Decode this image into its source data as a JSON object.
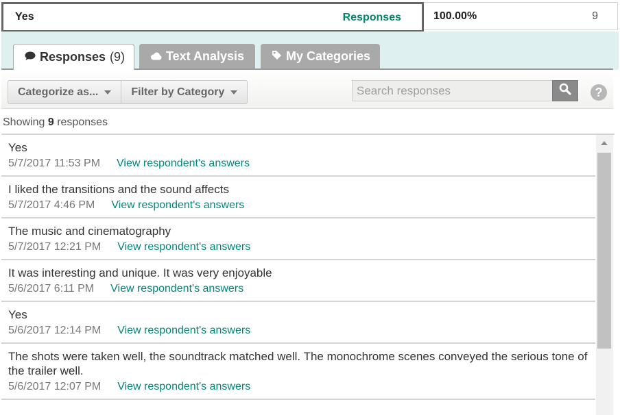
{
  "summary": {
    "answer": "Yes",
    "responses_link": "Responses",
    "percent": "100.00%",
    "count": "9"
  },
  "tabs": [
    {
      "label": "Responses",
      "count": "(9)",
      "icon": "speech-bubble-icon",
      "active": true
    },
    {
      "label": "Text Analysis",
      "icon": "cloud-icon",
      "active": false
    },
    {
      "label": "My Categories",
      "icon": "tag-icon",
      "active": false
    }
  ],
  "toolbar": {
    "categorize_label": "Categorize as...",
    "filter_label": "Filter by Category",
    "search_placeholder": "Search responses",
    "help_label": "?"
  },
  "showing": {
    "prefix": "Showing",
    "count": "9",
    "suffix": "responses"
  },
  "responses": [
    {
      "text": "Yes",
      "date": "5/7/2017 11:53 PM",
      "link": "View respondent's answers"
    },
    {
      "text": "I liked the transitions and the sound affects",
      "date": "5/7/2017 4:46 PM",
      "link": "View respondent's answers"
    },
    {
      "text": "The music and cinematography",
      "date": "5/7/2017 12:21 PM",
      "link": "View respondent's answers"
    },
    {
      "text": "It was interesting and unique. It was very enjoyable",
      "date": "5/6/2017 6:11 PM",
      "link": "View respondent's answers"
    },
    {
      "text": "Yes",
      "date": "5/6/2017 12:14 PM",
      "link": "View respondent's answers"
    },
    {
      "text": "The shots were taken well, the soundtrack matched well. The monochrome scenes conveyed the serious tone of the trailer well.",
      "date": "5/6/2017 12:07 PM",
      "link": "View respondent's answers"
    }
  ],
  "colors": {
    "accent": "#00856f",
    "tab_bar": "#dff0f0",
    "inactive_tab": "#a9a9a9"
  }
}
